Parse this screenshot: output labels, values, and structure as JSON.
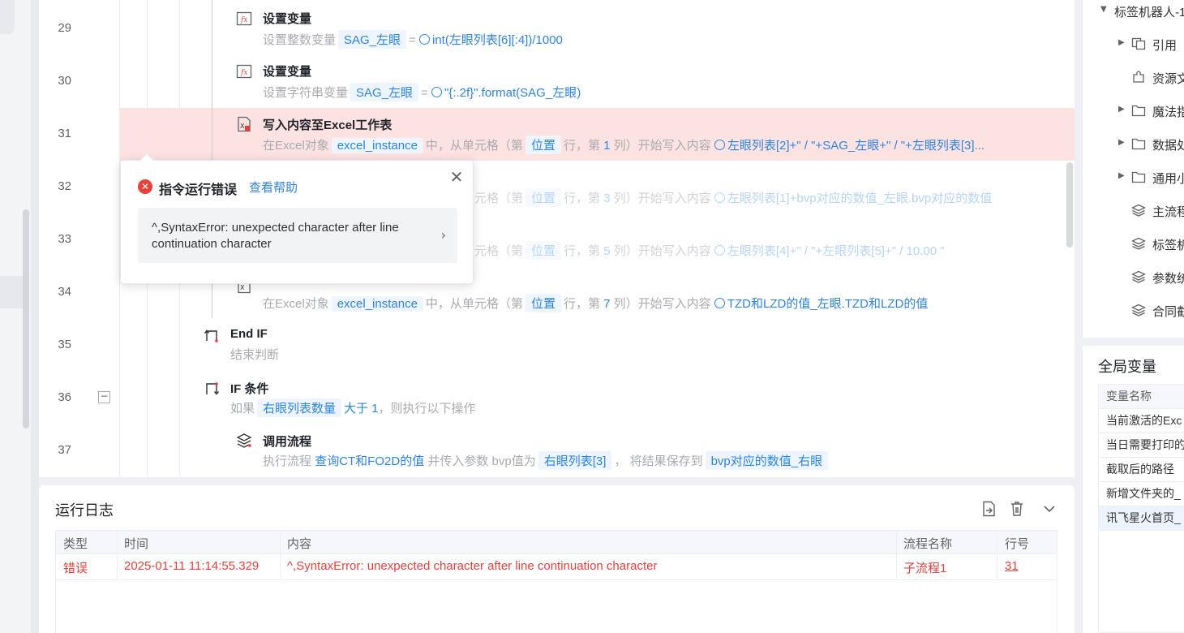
{
  "editor": {
    "line_numbers": [
      "29",
      "30",
      "31",
      "32",
      "33",
      "34",
      "35",
      "36",
      "37"
    ],
    "steps": [
      {
        "title": "设置变量",
        "desc_prefix": "设置整数变量",
        "var": "SAG_左眼",
        "eq": "=",
        "expr": "int(左眼列表[6][:4])/1000"
      },
      {
        "title": "设置变量",
        "desc_prefix": "设置字符串变量",
        "var": "SAG_左眼",
        "eq": "=",
        "expr": "\"{:.2f}\".format(SAG_左眼)"
      },
      {
        "title": "写入内容至Excel工作表",
        "p1": "在Excel对象",
        "obj": "excel_instance",
        "p2": "中，从单元格（第",
        "pos": "位置",
        "p3": "行，第",
        "col": "1",
        "p4": "列）开始写入内容",
        "content": "左眼列表[2]+\" / \"+SAG_左眼+\" / \"+左眼列表[3]..."
      },
      {
        "p1": "元格（第",
        "pos": "位置",
        "p3": "行，第",
        "col": "3",
        "p4": "列）开始写入内容",
        "content": "左眼列表[1]+bvp对应的数值_左眼.bvp对应的数值"
      },
      {
        "p1": "元格（第",
        "pos": "位置",
        "p3": "行，第",
        "col": "5",
        "p4": "列）开始写入内容",
        "content": "左眼列表[4]+\" / \"+左眼列表[5]+\" / 10.00 \""
      },
      {
        "p1": "在Excel对象",
        "obj": "excel_instance",
        "p2": "中，从单元格（第",
        "pos": "位置",
        "p3": "行，第",
        "col": "7",
        "p4": "列）开始写入内容",
        "content": "TZD和LZD的值_左眼.TZD和LZD的值"
      },
      {
        "title": "End IF",
        "desc": "结束判断"
      },
      {
        "title": "IF 条件",
        "p1": "如果",
        "var": "右眼列表数量",
        "cond": "大于 1",
        "p2": "，则执行以下操作"
      },
      {
        "title": "调用流程",
        "p1": "执行流程",
        "flow": "查询CT和FO2D的值",
        "p2": "并传入参数 bvp值为",
        "arg": "右眼列表[3]",
        "p3": "，  将结果保存到",
        "out": "bvp对应的数值_右眼"
      }
    ],
    "fold_symbol": "−"
  },
  "error_popover": {
    "title": "指令运行错误",
    "help_link": "查看帮助",
    "message": "^,SyntaxError: unexpected character after line continuation character",
    "close": "✕",
    "chevron": "›"
  },
  "log": {
    "title": "运行日志",
    "columns": [
      "类型",
      "时间",
      "内容",
      "流程名称",
      "行号"
    ],
    "rows": [
      {
        "type": "错误",
        "time": "2025-01-11 11:14:55.329",
        "content": "^,SyntaxError: unexpected character after line continuation character",
        "flow": "子流程1",
        "line": "31"
      }
    ]
  },
  "right_panel": {
    "tree": [
      {
        "label": "标签机器人-1",
        "icon": "caret-down",
        "level": 0
      },
      {
        "label": "引用",
        "icon": "reference-icon",
        "level": 1
      },
      {
        "label": "资源文",
        "icon": "puzzle-icon",
        "level": 1
      },
      {
        "label": "魔法指",
        "icon": "folder-icon",
        "level": 1
      },
      {
        "label": "数据处",
        "icon": "folder-icon",
        "level": 1
      },
      {
        "label": "通用小",
        "icon": "folder-icon",
        "level": 1
      },
      {
        "label": "主流程",
        "icon": "layers-icon",
        "level": 1
      },
      {
        "label": "标签机",
        "icon": "layers-icon",
        "level": 1
      },
      {
        "label": "参数统",
        "icon": "layers-icon",
        "level": 1
      },
      {
        "label": "合同截",
        "icon": "layers-icon",
        "level": 1
      }
    ],
    "global_vars_title": "全局变量",
    "var_header": "变量名称",
    "vars": [
      "当前激活的Exc",
      "当日需要打印的",
      "截取后的路径",
      "新增文件夹的_",
      "讯飞星火首页_"
    ]
  }
}
